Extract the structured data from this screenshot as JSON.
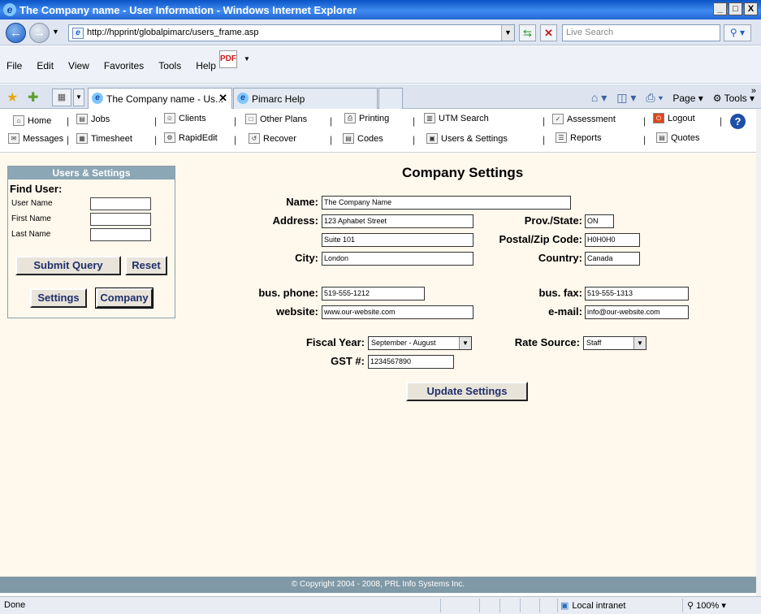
{
  "window": {
    "title": "The Company name - User Information - Windows Internet Explorer",
    "minimize": "_",
    "maximize": "□",
    "close": "X"
  },
  "address": {
    "url": "http://hpprint/globalpimarc/users_frame.asp",
    "search_placeholder": "Live Search"
  },
  "menu": {
    "items": [
      "File",
      "Edit",
      "View",
      "Favorites",
      "Tools",
      "Help"
    ]
  },
  "tabs": {
    "active": "The Company name - Us...",
    "second": "Pimarc Help"
  },
  "command_bar": {
    "page": "Page",
    "tools": "Tools"
  },
  "app_nav": {
    "row1": [
      "Home",
      "Jobs",
      "Clients",
      "Other Plans",
      "Printing",
      "UTM Search",
      "Assessment",
      "Logout"
    ],
    "row2": [
      "Messages",
      "Timesheet",
      "RapidEdit",
      "Recover",
      "Codes",
      "Users & Settings",
      "Reports",
      "Quotes"
    ],
    "help": "?"
  },
  "left_panel": {
    "title": "Users & Settings",
    "find_user": "Find User:",
    "user_name": "User Name",
    "first_name": "First Name",
    "last_name": "Last Name",
    "submit": "Submit Query",
    "reset": "Reset",
    "settings": "Settings",
    "company": "Company"
  },
  "form": {
    "title": "Company Settings",
    "name_label": "Name:",
    "name_value": "The Company Name",
    "address_label": "Address:",
    "address1": "123 Aphabet Street",
    "address2": "Suite 101",
    "city_label": "City:",
    "city_value": "London",
    "prov_label": "Prov./State:",
    "prov_value": "ON",
    "postal_label": "Postal/Zip Code:",
    "postal_value": "H0H0H0",
    "country_label": "Country:",
    "country_value": "Canada",
    "phone_label": "bus. phone:",
    "phone_value": "519-555-1212",
    "fax_label": "bus. fax:",
    "fax_value": "519-555-1313",
    "website_label": "website:",
    "website_value": "www.our-website.com",
    "email_label": "e-mail:",
    "email_value": "info@our-website.com",
    "fiscal_label": "Fiscal Year:",
    "fiscal_value": "September - August",
    "rate_label": "Rate Source:",
    "rate_value": "Staff",
    "gst_label": "GST #:",
    "gst_value": "1234567890",
    "update": "Update Settings"
  },
  "footer": "© Copyright 2004 - 2008, PRL Info Systems Inc.",
  "status": {
    "done": "Done",
    "zone": "Local intranet",
    "zoom": "100%"
  }
}
